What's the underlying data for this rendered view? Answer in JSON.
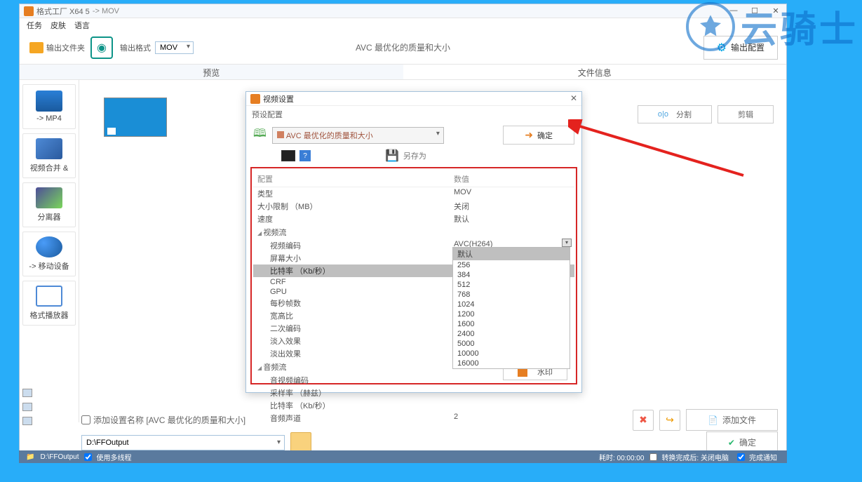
{
  "watermark": "云骑士",
  "main_window": {
    "title": "格式工厂 X64 5",
    "breadcrumb": "-> MOV",
    "menu": {
      "task": "任务",
      "skin": "皮肤",
      "lang": "语言"
    },
    "toolbar": {
      "output_folder": "输出文件夹",
      "output_format": "输出格式",
      "format_value": "MOV",
      "center_label": "AVC 最优化的质量和大小",
      "config_btn": "输出配置"
    },
    "tabs": {
      "preview": "预览",
      "fileinfo": "文件信息"
    },
    "sidebar": {
      "mp4": "-> MP4",
      "merge": "视频合并 &",
      "splitter": "分离器",
      "mobile": "-> 移动设备",
      "player": "格式播放器"
    },
    "right_tools": {
      "split": "分割",
      "cut": "剪辑"
    },
    "bottom": {
      "add_cfg_name": "添加设置名称 [AVC 最优化的质量和大小]",
      "add_file": "添加文件",
      "ok": "确定",
      "output_path": "D:\\FFOutput"
    },
    "status": {
      "path": "D:\\FFOutput",
      "multithread": "使用多线程",
      "elapsed": "耗时: 00:00:00",
      "after": "转换完成后: 关闭电脑",
      "notify": "完成通知"
    }
  },
  "modal": {
    "title": "视频设置",
    "preset_label": "预设配置",
    "preset_value": "AVC 最优化的质量和大小",
    "ok": "确定",
    "save_as": "另存为",
    "hdr_cfg": "配置",
    "hdr_val": "数值",
    "rows": {
      "type": "类型",
      "type_v": "MOV",
      "sizelim": "大小限制 （MB）",
      "sizelim_v": "关闭",
      "speed": "速度",
      "speed_v": "默认",
      "vstream": "视频流",
      "vcodec": "视频编码",
      "vcodec_v": "AVC(H264)",
      "screensize": "屏幕大小",
      "screensize_v": "默认",
      "bitrate": "比特率 （Kb/秒）",
      "crf": "CRF",
      "gpu": "GPU",
      "fps": "每秒帧数",
      "ratio": "宽高比",
      "twopass": "二次编码",
      "fadein": "淡入效果",
      "fadeout": "淡出效果",
      "astream": "音频流",
      "acodec": "音视频编码",
      "srate": "采样率 （赫兹）",
      "abitrate": "比特率 （Kb/秒）",
      "channels": "音频声道",
      "channels_v": "2"
    },
    "dropdown": {
      "v1": "默认",
      "v2": "256",
      "v3": "384",
      "v4": "512",
      "v5": "768",
      "v6": "1024",
      "v7": "1200",
      "v8": "1600",
      "v9": "2400",
      "v10": "5000",
      "v11": "10000",
      "v12": "16000"
    },
    "watermark_btn": "水印"
  }
}
